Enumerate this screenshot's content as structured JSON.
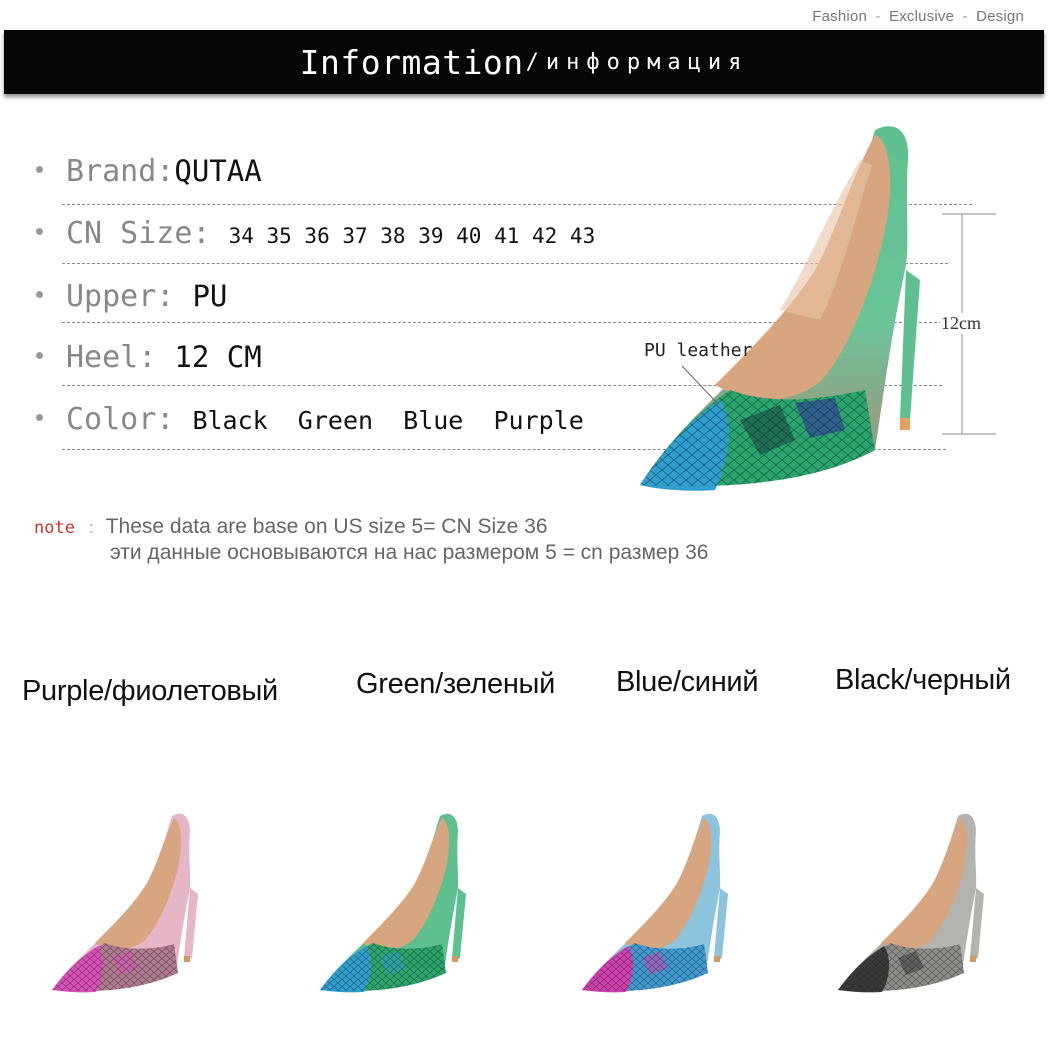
{
  "tagline": {
    "w1": "Fashion",
    "w2": "Exclusive",
    "w3": "Design",
    "sep": "-"
  },
  "banner": {
    "title": "Information",
    "subtitle": "/информация"
  },
  "specs": [
    {
      "label": "Brand:",
      "value": "QUTAA"
    },
    {
      "label": "CN Size:",
      "value": "34 35 36 37 38 39 40 41 42 43"
    },
    {
      "label": "Upper:",
      "value": "PU"
    },
    {
      "label": "Heel:",
      "value": "12 CM"
    },
    {
      "label": "Color:",
      "value": "Black  Green  Blue  Purple"
    }
  ],
  "note": {
    "key": "note",
    "colon": ":",
    "line1": "These data are base on US size 5= CN Size 36",
    "line2": "эти данные основываются на нас размером 5 = cn размер 36"
  },
  "hero": {
    "callout": "PU leather",
    "heel_height": "12cm"
  },
  "variants": [
    {
      "label": "Purple/фиолетовый",
      "upper": "#e6b6c8",
      "accent": "#d94fb7",
      "snake2": "#b07a90"
    },
    {
      "label": "Green/зеленый",
      "upper": "#5ec08f",
      "accent": "#2f9fd0",
      "snake2": "#2aa56b"
    },
    {
      "label": "Blue/синий",
      "upper": "#8cc3dd",
      "accent": "#cf3fae",
      "snake2": "#3f9bd1"
    },
    {
      "label": "Black/черный",
      "upper": "#b2b4ad",
      "accent": "#3a3a3a",
      "snake2": "#8c8c88"
    }
  ],
  "colors": {
    "banner_bg": "#060606",
    "note_key": "#c0392b",
    "hero_upper": "#5ec08f",
    "hero_accent": "#2f9fd0"
  }
}
